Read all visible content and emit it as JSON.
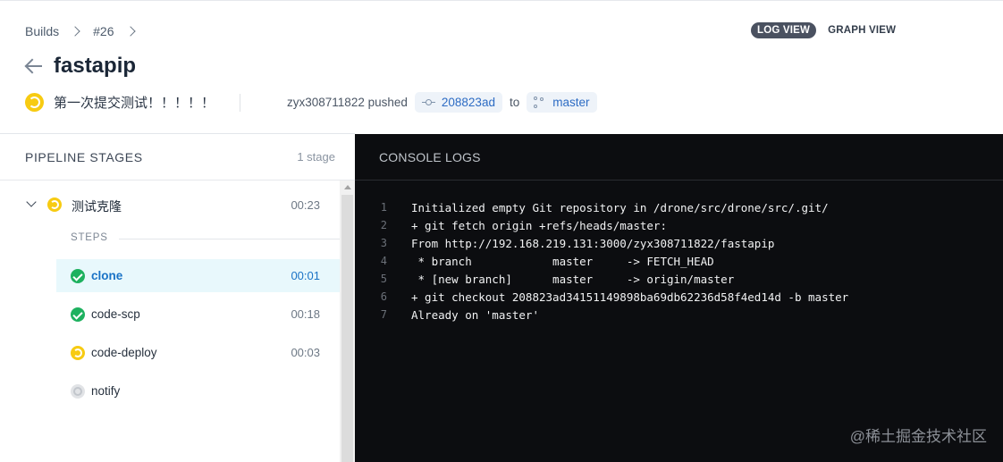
{
  "breadcrumb": {
    "builds": "Builds",
    "build_number": "#26"
  },
  "view_toggle": {
    "log_view": "LOG VIEW",
    "graph_view": "GRAPH VIEW"
  },
  "repo": {
    "name": "fastapip"
  },
  "commit": {
    "message": "第一次提交测试！！！！！",
    "pusher": "zyx308711822 pushed",
    "sha": "208823ad",
    "to_text": "to",
    "branch": "master",
    "status": "running",
    "status_color": "#f7cb12"
  },
  "stages": {
    "title": "PIPELINE STAGES",
    "count": "1 stage",
    "items": [
      {
        "name": "测试克隆",
        "time": "00:23",
        "status": "running",
        "steps_label": "STEPS",
        "steps": [
          {
            "name": "clone",
            "time": "00:01",
            "status": "success",
            "active": true
          },
          {
            "name": "code-scp",
            "time": "00:18",
            "status": "success"
          },
          {
            "name": "code-deploy",
            "time": "00:03",
            "status": "running"
          },
          {
            "name": "notify",
            "time": "",
            "status": "pending"
          }
        ]
      }
    ]
  },
  "console": {
    "title": "CONSOLE LOGS",
    "lines": [
      {
        "n": "1",
        "text": "Initialized empty Git repository in /drone/src/drone/src/.git/"
      },
      {
        "n": "2",
        "text": "+ git fetch origin +refs/heads/master:"
      },
      {
        "n": "3",
        "text": "From http://192.168.219.131:3000/zyx308711822/fastapip"
      },
      {
        "n": "4",
        "text": " * branch            master     -> FETCH_HEAD"
      },
      {
        "n": "5",
        "text": " * [new branch]      master     -> origin/master"
      },
      {
        "n": "6",
        "text": "+ git checkout 208823ad34151149898ba69db62236d58f4ed14d -b master"
      },
      {
        "n": "7",
        "text": "Already on 'master'"
      }
    ]
  },
  "watermark": "@稀土掘金技术社区",
  "colors": {
    "success": "#1eb15f",
    "running": "#f7cb12",
    "pending": "#e1e3e6",
    "link": "#2d6cc4",
    "console_bg": "#0c0d10"
  }
}
